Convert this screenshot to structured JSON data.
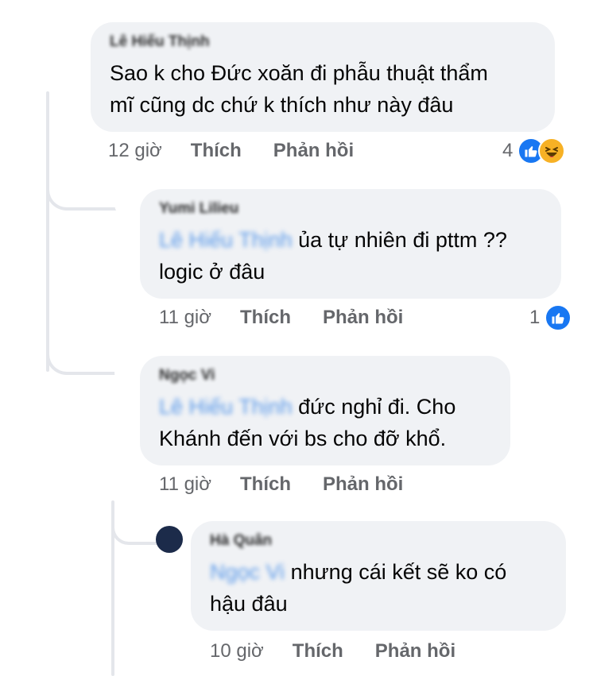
{
  "comments": [
    {
      "author": "Lê Hiếu Thịnh",
      "mention": "",
      "text_line1": "Sao k cho Đức xoăn đi phẫu thuật thẩm",
      "text_line2": "mĩ cũng dc chứ k thích như này đâu",
      "time": "12 giờ",
      "like_label": "Thích",
      "reply_label": "Phản hồi",
      "reaction_count": "4",
      "reactions": [
        "like-icon",
        "haha-icon"
      ]
    },
    {
      "author": "Yumi Lilieu",
      "mention": "Lê Hiếu Thịnh",
      "text_line1": "ủa tự nhiên đi pttm ??",
      "text_line2": "logic ở đâu",
      "time": "11 giờ",
      "like_label": "Thích",
      "reply_label": "Phản hồi",
      "reaction_count": "1",
      "reactions": [
        "like-icon"
      ]
    },
    {
      "author": "Ngọc Vi",
      "mention": "Lê Hiếu Thịnh",
      "text_line1": "đức nghỉ đi. Cho",
      "text_line2": "Khánh đến với bs cho đỡ khổ.",
      "time": "11 giờ",
      "like_label": "Thích",
      "reply_label": "Phản hồi"
    },
    {
      "author": "Hà Quân",
      "mention": "Ngọc Vi",
      "text_line1": "nhưng cái kết sẽ ko có",
      "text_line2": "hậu đâu",
      "time": "10 giờ",
      "like_label": "Thích",
      "reply_label": "Phản hồi"
    }
  ],
  "colors": {
    "bubble": "#f0f2f5",
    "meta_text": "#65676b",
    "mention": "#1b74e4",
    "like_blue": "#1877f2",
    "haha_yellow": "#f7b125",
    "thread_line": "#e4e6eb"
  }
}
